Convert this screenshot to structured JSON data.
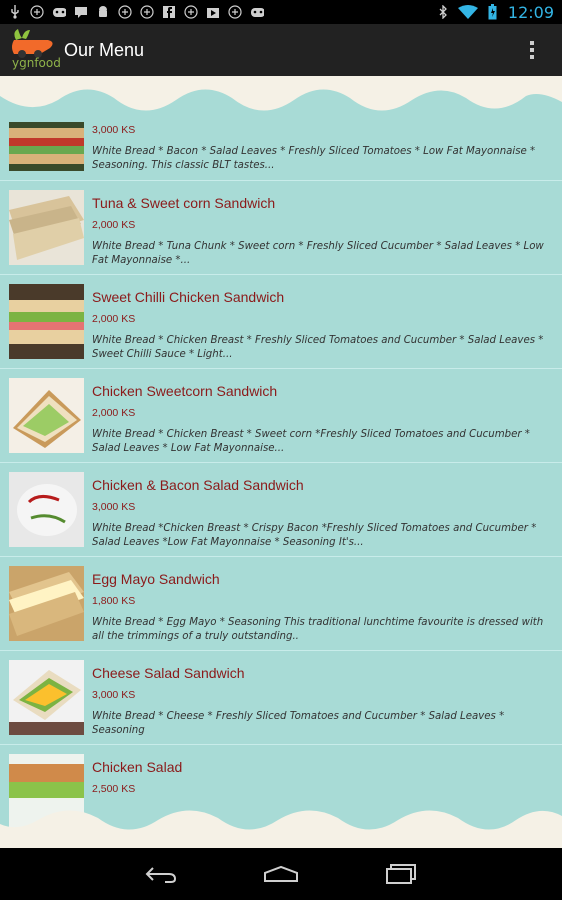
{
  "status_bar": {
    "time": "12:09",
    "notification_icons": [
      "usb-icon",
      "add-icon",
      "game-icon",
      "chat-icon",
      "android-icon",
      "add-icon",
      "add-icon",
      "facebook-icon",
      "add-icon",
      "play-store-icon",
      "add-icon",
      "game-icon"
    ],
    "system_icons": [
      "bluetooth-icon",
      "wifi-icon",
      "battery-icon"
    ]
  },
  "action_bar": {
    "logo_text": "ygnfood",
    "title": "Our Menu"
  },
  "menu_items": [
    {
      "name": "",
      "price": "3,000 KS",
      "description": "White Bread * Bacon * Salad Leaves * Freshly Sliced Tomatoes * Low Fat Mayonnaise * Seasoning. This classic BLT tastes..."
    },
    {
      "name": "Tuna & Sweet corn Sandwich",
      "price": "2,000 KS",
      "description": "White Bread * Tuna Chunk * Sweet corn * Freshly Sliced Cucumber * Salad Leaves * Low Fat Mayonnaise *..."
    },
    {
      "name": "Sweet Chilli Chicken Sandwich",
      "price": "2,000 KS",
      "description": "White Bread * Chicken Breast * Freshly Sliced Tomatoes and Cucumber * Salad Leaves * Sweet Chilli Sauce * Light..."
    },
    {
      "name": "Chicken Sweetcorn Sandwich",
      "price": "2,000 KS",
      "description": "White Bread * Chicken Breast * Sweet corn *Freshly Sliced Tomatoes and Cucumber * Salad Leaves * Low Fat Mayonnaise..."
    },
    {
      "name": "Chicken & Bacon Salad Sandwich",
      "price": "3,000 KS",
      "description": "White Bread *Chicken Breast * Crispy Bacon *Freshly Sliced Tomatoes and Cucumber * Salad Leaves *Low Fat Mayonnaise * Seasoning It's..."
    },
    {
      "name": "Egg Mayo Sandwich",
      "price": "1,800 KS",
      "description": "White Bread * Egg Mayo * Seasoning This traditional lunchtime favourite is dressed with all the trimmings of a truly outstanding.."
    },
    {
      "name": "Cheese Salad Sandwich",
      "price": "3,000 KS",
      "description": "White Bread * Cheese * Freshly Sliced Tomatoes and Cucumber * Salad Leaves * Seasoning"
    },
    {
      "name": "Chicken Salad",
      "price": "2,500 KS",
      "description": ""
    }
  ],
  "colors": {
    "content_bg": "#a8dbd6",
    "cloud": "#f5f1e6",
    "item_title": "#8b1a1a",
    "clock": "#33b5e5"
  },
  "nav_bar": {
    "buttons": [
      "back-icon",
      "home-icon",
      "recent-apps-icon"
    ]
  }
}
